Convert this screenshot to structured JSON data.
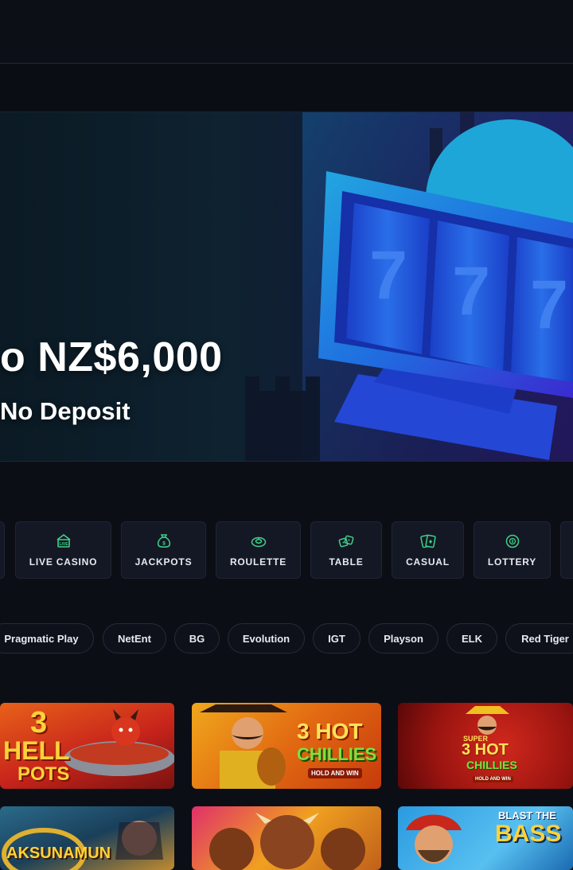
{
  "hero": {
    "title": "o NZ$6,000",
    "subtitle": "No Deposit",
    "reel_digits": [
      "7",
      "7",
      "7"
    ]
  },
  "categories": [
    {
      "label": "LIVE CASINO",
      "icon": "live-casino-icon"
    },
    {
      "label": "JACKPOTS",
      "icon": "money-bag-icon"
    },
    {
      "label": "ROULETTE",
      "icon": "roulette-icon"
    },
    {
      "label": "TABLE",
      "icon": "dice-icon"
    },
    {
      "label": "CASUAL",
      "icon": "cards-icon"
    },
    {
      "label": "LOTTERY",
      "icon": "lottery-ball-icon"
    }
  ],
  "providers": [
    "Pragmatic Play",
    "NetEnt",
    "BG",
    "Evolution",
    "IGT",
    "Playson",
    "ELK",
    "Red Tiger"
  ],
  "games": [
    {
      "title_line1": "3",
      "title_line2": "HELL",
      "title_line3": "POTS"
    },
    {
      "title_line1": "3 HOT",
      "title_line2": "CHILLIES",
      "title_line3": "HOLD AND WIN"
    },
    {
      "title_line0": "SUPER",
      "title_line1": "3 HOT",
      "title_line2": "CHILLIES",
      "title_line3": "HOLD AND WIN"
    },
    {
      "title_line1": "AKSUNAMUN"
    },
    {
      "title_line1": ""
    },
    {
      "title_line1": "BLAST THE",
      "title_line2": "BASS"
    }
  ],
  "colors": {
    "accent_green": "#3fd08a",
    "background": "#0c0e16",
    "card": "#141824"
  }
}
